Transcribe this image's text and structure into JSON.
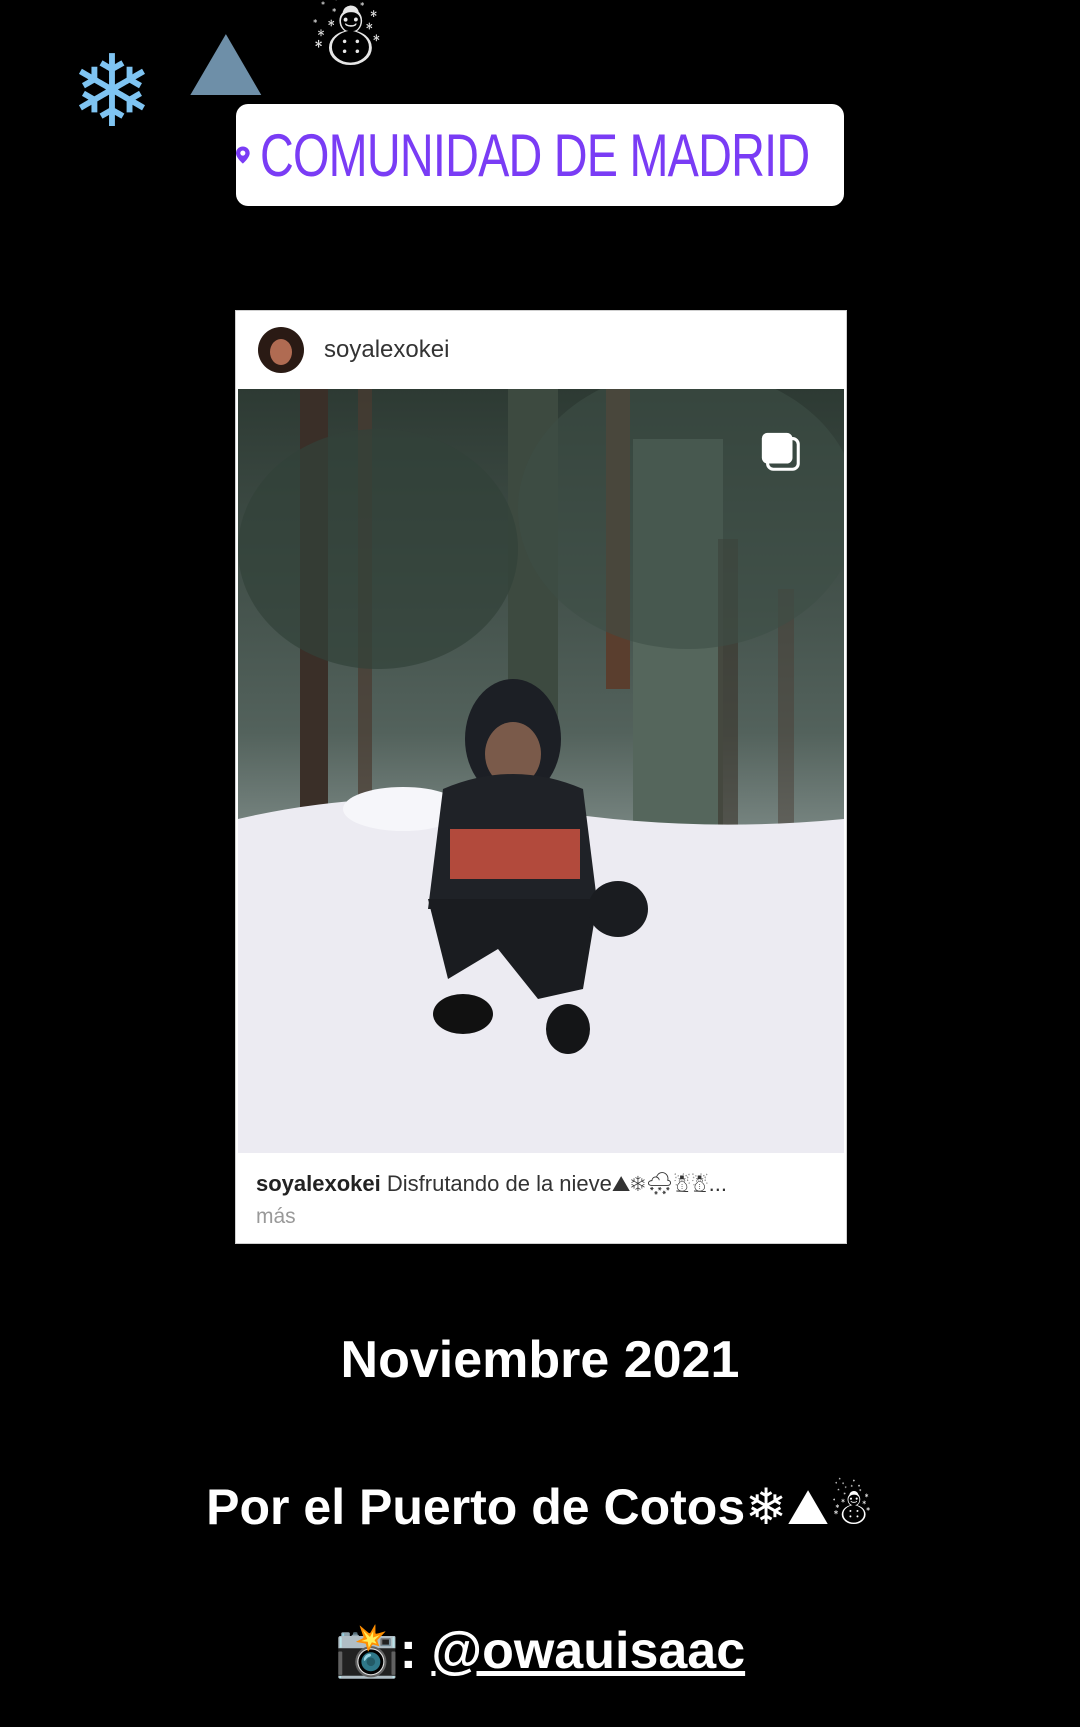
{
  "emojis": {
    "snowflake": "❄",
    "mountain": "⛰",
    "snowman": "☃"
  },
  "location": {
    "name": "COMUNIDAD DE MADRID"
  },
  "post": {
    "username": "soyalexokei",
    "caption_user": "soyalexokei",
    "caption_text": "Disfrutando de la nieve⛰❄🌨☃☃...",
    "more_label": "más"
  },
  "story": {
    "date": "Noviembre 2021",
    "place": "Por el Puerto de Cotos",
    "place_emojis": "❄⛰☃",
    "camera_emoji": "📸",
    "credit_sep": ":",
    "mention": "@owauisaac"
  },
  "colors": {
    "location_accent": "#7a3cf5",
    "background": "#000000"
  }
}
